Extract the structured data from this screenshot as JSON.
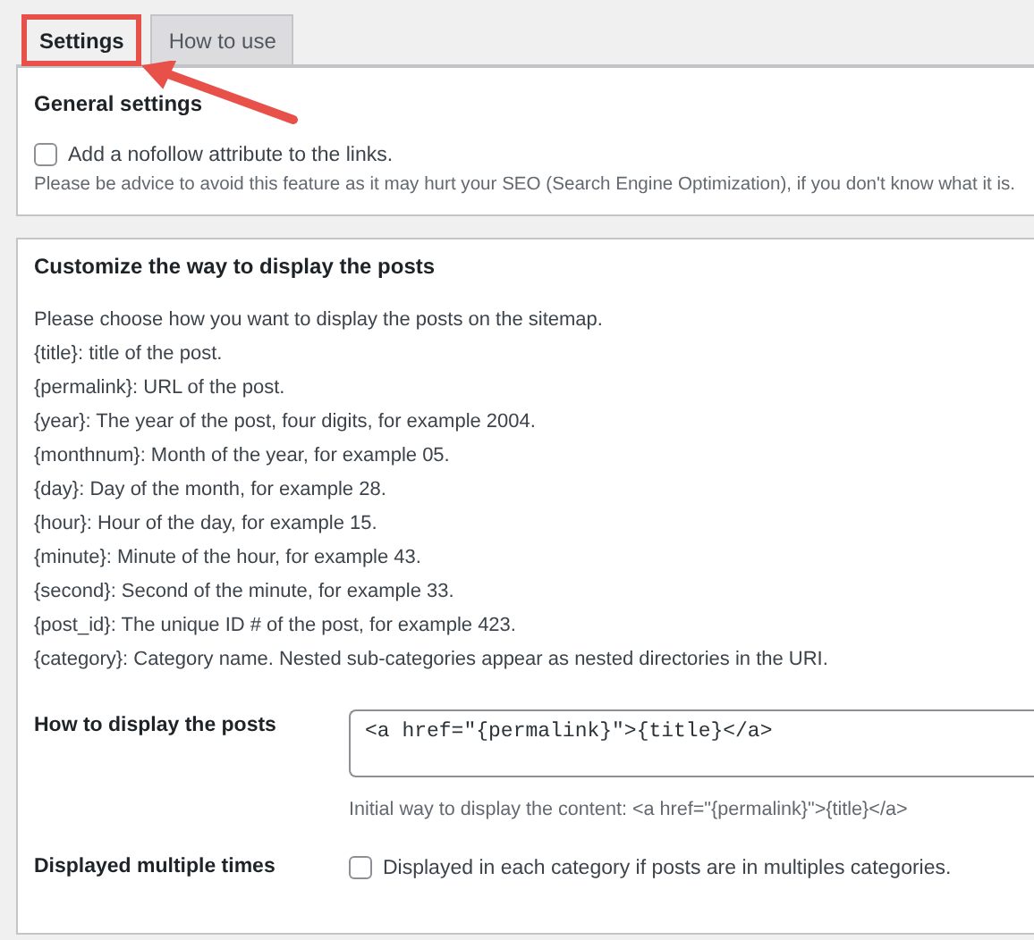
{
  "tabs": [
    {
      "label": "Settings",
      "selected": true,
      "highlighted": true
    },
    {
      "label": "How to use",
      "selected": false,
      "highlighted": false
    }
  ],
  "general_settings": {
    "title": "General settings",
    "nofollow": {
      "label": "Add a nofollow attribute to the links.",
      "checked": false
    },
    "note": "Please be advice to avoid this feature as it may hurt your SEO (Search Engine Optimization), if you don't know what it is."
  },
  "display_posts": {
    "title": "Customize the way to display the posts",
    "intro": "Please choose how you want to display the posts on the sitemap.",
    "tokens": [
      "{title}: title of the post.",
      "{permalink}: URL of the post.",
      "{year}: The year of the post, four digits, for example 2004.",
      "{monthnum}: Month of the year, for example 05.",
      "{day}: Day of the month, for example 28.",
      "{hour}: Hour of the day, for example 15.",
      "{minute}: Minute of the hour, for example 43.",
      "{second}: Second of the minute, for example 33.",
      "{post_id}: The unique ID # of the post, for example 423.",
      "{category}: Category name. Nested sub-categories appear as nested directories in the URI."
    ],
    "how_to_display": {
      "label": "How to display the posts",
      "value": "<a href=\"{permalink}\">{title}</a>",
      "help": "Initial way to display the content: <a href=\"{permalink}\">{title}</a>"
    },
    "multiple_times": {
      "label": "Displayed multiple times",
      "option": "Displayed in each category if posts are in multiples categories.",
      "checked": false
    }
  }
}
